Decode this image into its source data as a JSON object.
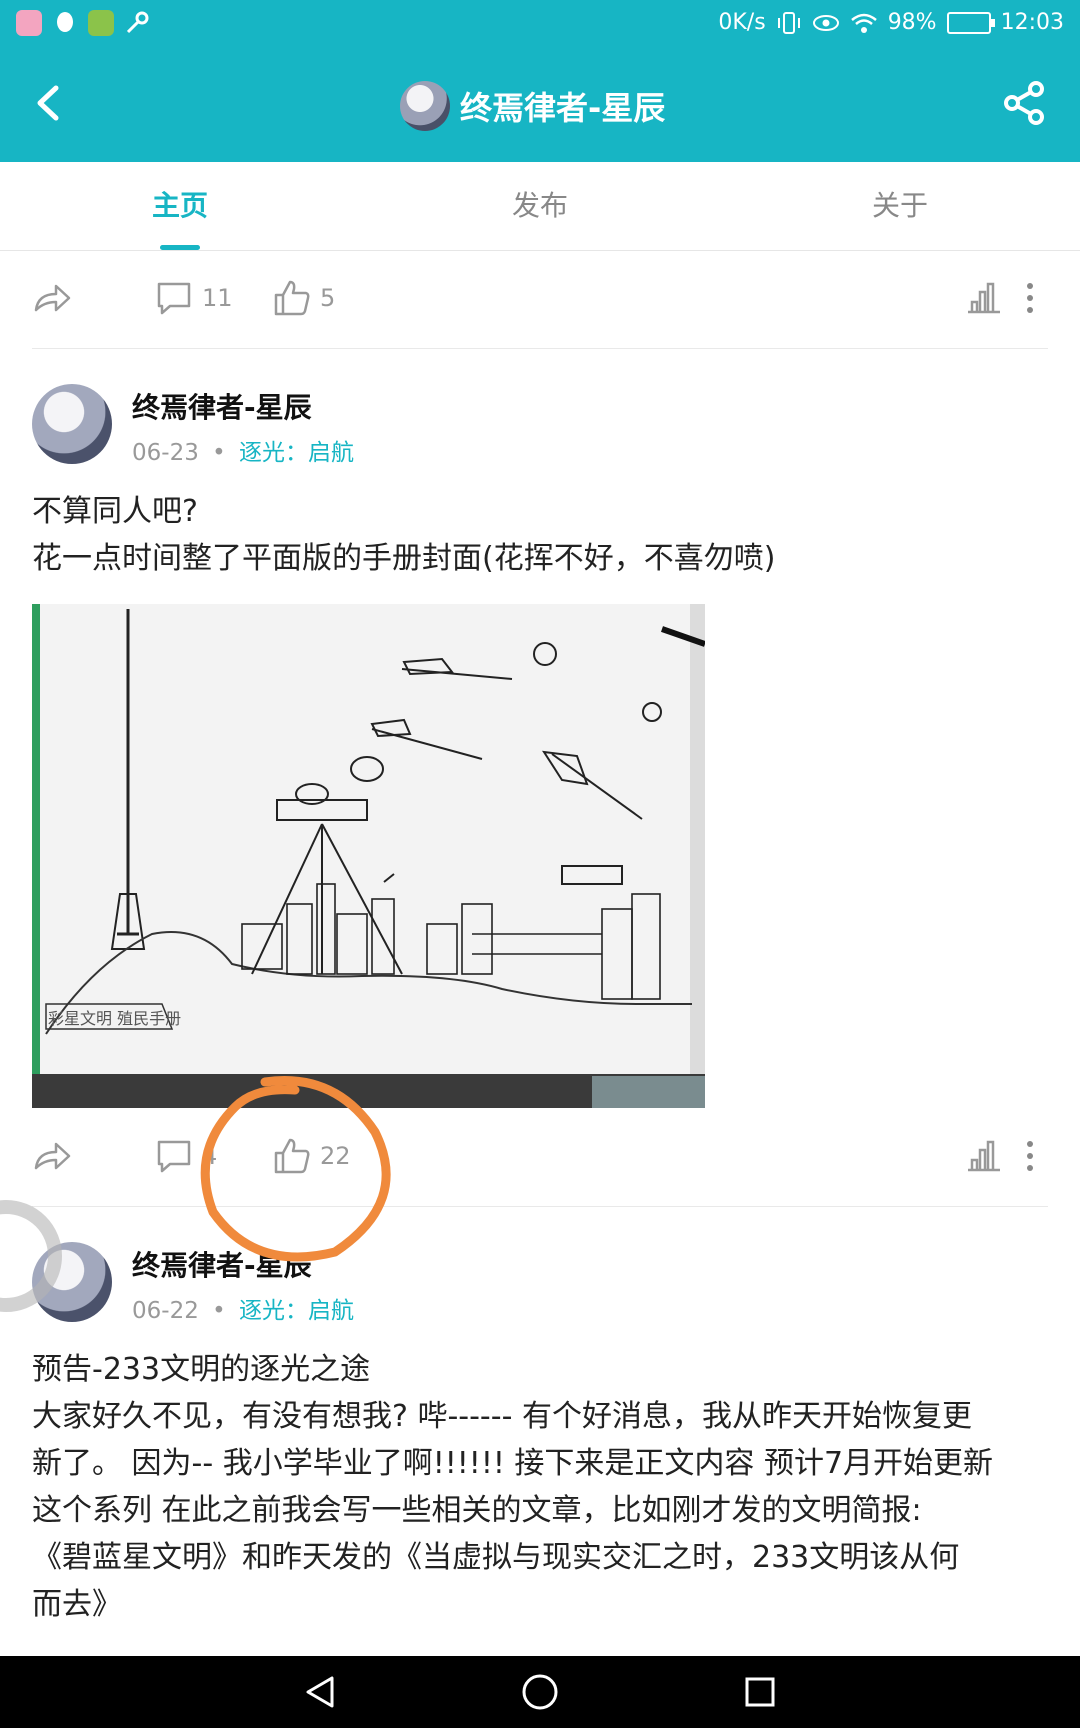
{
  "status_bar": {
    "network_speed": "0K/s",
    "battery": "98%",
    "time": "12:03"
  },
  "header": {
    "title": "终焉律者-星辰"
  },
  "tabs": [
    {
      "label": "主页"
    },
    {
      "label": "发布"
    },
    {
      "label": "关于"
    }
  ],
  "top_actions": {
    "comments": "11",
    "likes": "5"
  },
  "posts": [
    {
      "author": "终焉律者-星辰",
      "date": "06-23",
      "dot": "•",
      "tag": "逐光：启航",
      "text": [
        "不算同人吧?",
        "花一点时间整了平面版的手册封面(花挥不好，不喜勿喷)"
      ],
      "image_caption": "彩星文明 殖民手册",
      "comments": "4",
      "likes": "22"
    },
    {
      "author": "终焉律者-星辰",
      "date": "06-22",
      "dot": "•",
      "tag": "逐光：启航",
      "text": [
        "预告-233文明的逐光之途",
        "大家好久不见，有没有想我? 哔------ 有个好消息，我从昨天开始恢复更",
        "新了。 因为-- 我小学毕业了啊!!!!!! 接下来是正文内容 预计7月开始更新",
        "这个系列 在此之前我会写一些相关的文章，比如刚才发的文明简报:",
        "《碧蓝星文明》和昨天发的《当虚拟与现实交汇之时，233文明该从何",
        "而去》"
      ]
    }
  ],
  "colors": {
    "accent": "#17b5c4",
    "annotation": "#f08a3c"
  }
}
